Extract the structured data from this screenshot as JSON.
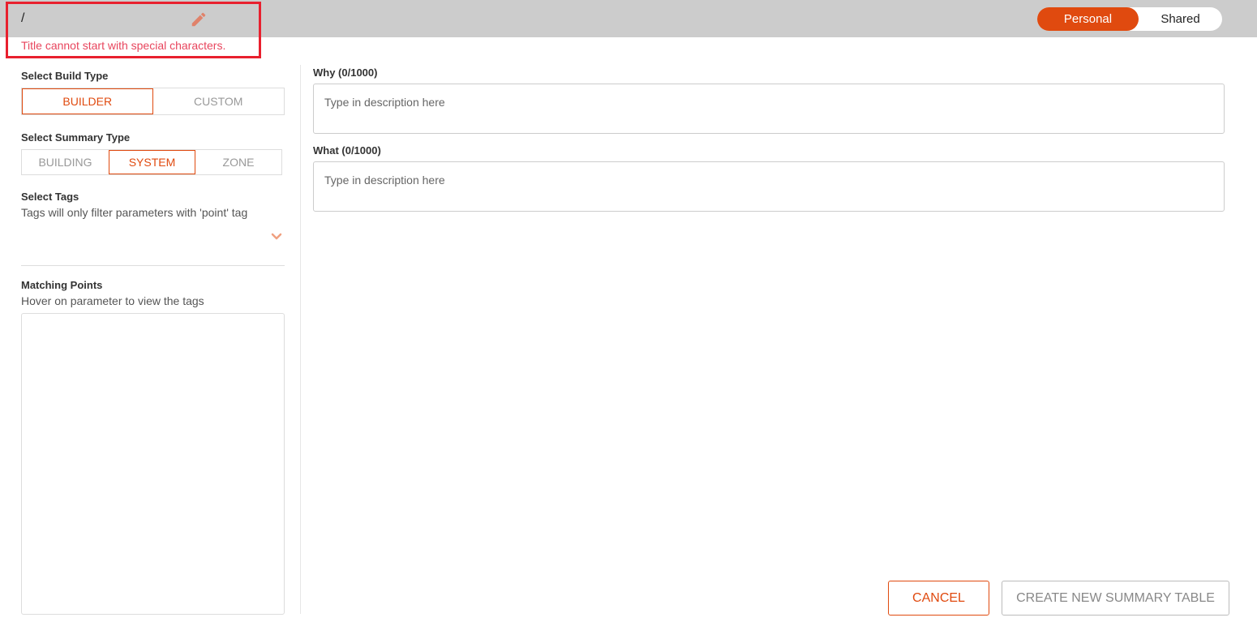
{
  "header": {
    "title": "/",
    "error": "Title cannot start with special characters.",
    "toggle": {
      "personal": "Personal",
      "shared": "Shared",
      "selected": "Personal"
    }
  },
  "build_type": {
    "label": "Select Build Type",
    "options": [
      "BUILDER",
      "CUSTOM"
    ],
    "selected": "BUILDER"
  },
  "summary_type": {
    "label": "Select Summary Type",
    "options": [
      "BUILDING",
      "SYSTEM",
      "ZONE"
    ],
    "selected": "SYSTEM"
  },
  "tags": {
    "label": "Select Tags",
    "hint": "Tags will only filter parameters with 'point' tag"
  },
  "matching_points": {
    "label": "Matching Points",
    "hint": "Hover on parameter to view the tags"
  },
  "why": {
    "label": "Why (0/1000)",
    "placeholder": "Type in description here"
  },
  "what": {
    "label": "What (0/1000)",
    "placeholder": "Type in description here"
  },
  "actions": {
    "cancel": "CANCEL",
    "create": "CREATE NEW SUMMARY TABLE"
  },
  "colors": {
    "accent": "#e04a0f",
    "error": "#e8455d",
    "header_bg": "#cccccc"
  }
}
